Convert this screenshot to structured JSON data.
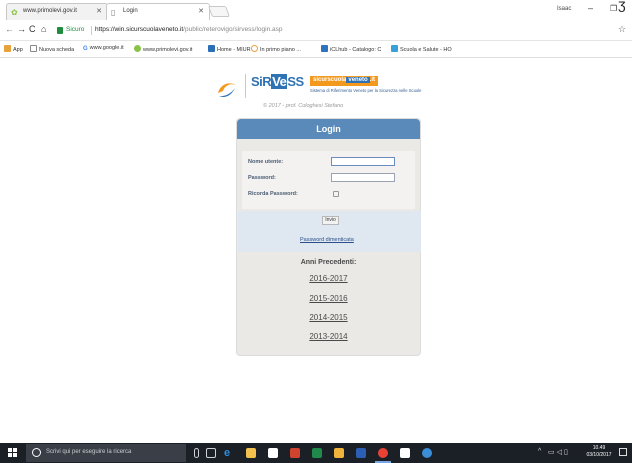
{
  "browser": {
    "tabs": [
      {
        "label": "www.primolevi.gov.it",
        "active": false
      },
      {
        "label": "Login",
        "active": true
      }
    ],
    "user_label": "Isaac",
    "address": {
      "secure_label": "Sicuro",
      "url_host": "https://win.sicurscuolaveneto.it",
      "url_path": "/public/reterovigo/sirvess/login.asp"
    },
    "bookmarks": [
      {
        "label": "App",
        "icon": "apps-grid-icon",
        "color": "#e8a23a"
      },
      {
        "label": "Nuova scheda",
        "icon": "page-icon",
        "color": "#888888"
      },
      {
        "label": "www.google.it",
        "icon": "google-icon",
        "color": "#4285f4"
      },
      {
        "label": "www.primolevi.gov.it",
        "icon": "site-icon",
        "color": "#8bc34a"
      },
      {
        "label": "Home - MIUR",
        "icon": "miur-icon",
        "color": "#2b6fb6"
      },
      {
        "label": "In primo piano ...",
        "icon": "news-icon",
        "color": "#e6a23c"
      },
      {
        "label": "iCLhub - Catalogo: C",
        "icon": "iclhub-icon",
        "color": "#2f72bd"
      },
      {
        "label": "Scuola e Salute - HO",
        "icon": "health-icon",
        "color": "#3aa0d8"
      }
    ]
  },
  "page": {
    "logo": {
      "sir": "SiR",
      "ve": "Ve",
      "ss": "SS",
      "brand_a": "sicurscuola",
      "brand_b": "veneto",
      "brand_c": ".it",
      "subtitle": "Sistema di Riferimento Veneto per la Sicurezza nelle Scuole"
    },
    "credit": "© 2017 - prof. Cologhesi Stefano",
    "login": {
      "title": "Login",
      "username_label": "Nome utente:",
      "username_value": "",
      "password_label": "Password:",
      "password_value": "",
      "remember_label": "Ricorda Password:",
      "remember_checked": false,
      "submit_label": "Invio",
      "forgot_label": "Password dimenticata"
    },
    "previous": {
      "title": "Anni Precedenti:",
      "years": [
        "2016-2017",
        "2015-2016",
        "2014-2015",
        "2013-2014"
      ]
    }
  },
  "taskbar": {
    "search_placeholder": "Scrivi qui per eseguire la ricerca",
    "time": "10.49",
    "date": "03/10/2017",
    "apps": [
      {
        "icon": "microphone-icon",
        "color": "#cfd3d8"
      },
      {
        "icon": "task-view-icon",
        "color": "#cfd3d8"
      },
      {
        "icon": "edge-icon",
        "color": "#2b8fe0"
      },
      {
        "icon": "file-explorer-icon",
        "color": "#f2c14e"
      },
      {
        "icon": "store-icon",
        "color": "#ffffff"
      },
      {
        "icon": "powerpoint-icon",
        "color": "#d0442f"
      },
      {
        "icon": "excel-icon",
        "color": "#1f8a4c"
      },
      {
        "icon": "paint-icon",
        "color": "#f0b43c"
      },
      {
        "icon": "word-icon",
        "color": "#2b5fb3"
      },
      {
        "icon": "chrome-icon",
        "color": "#e94235"
      },
      {
        "icon": "mail-icon",
        "color": "#ffffff"
      },
      {
        "icon": "network-icon",
        "color": "#3b8fd9"
      }
    ]
  }
}
